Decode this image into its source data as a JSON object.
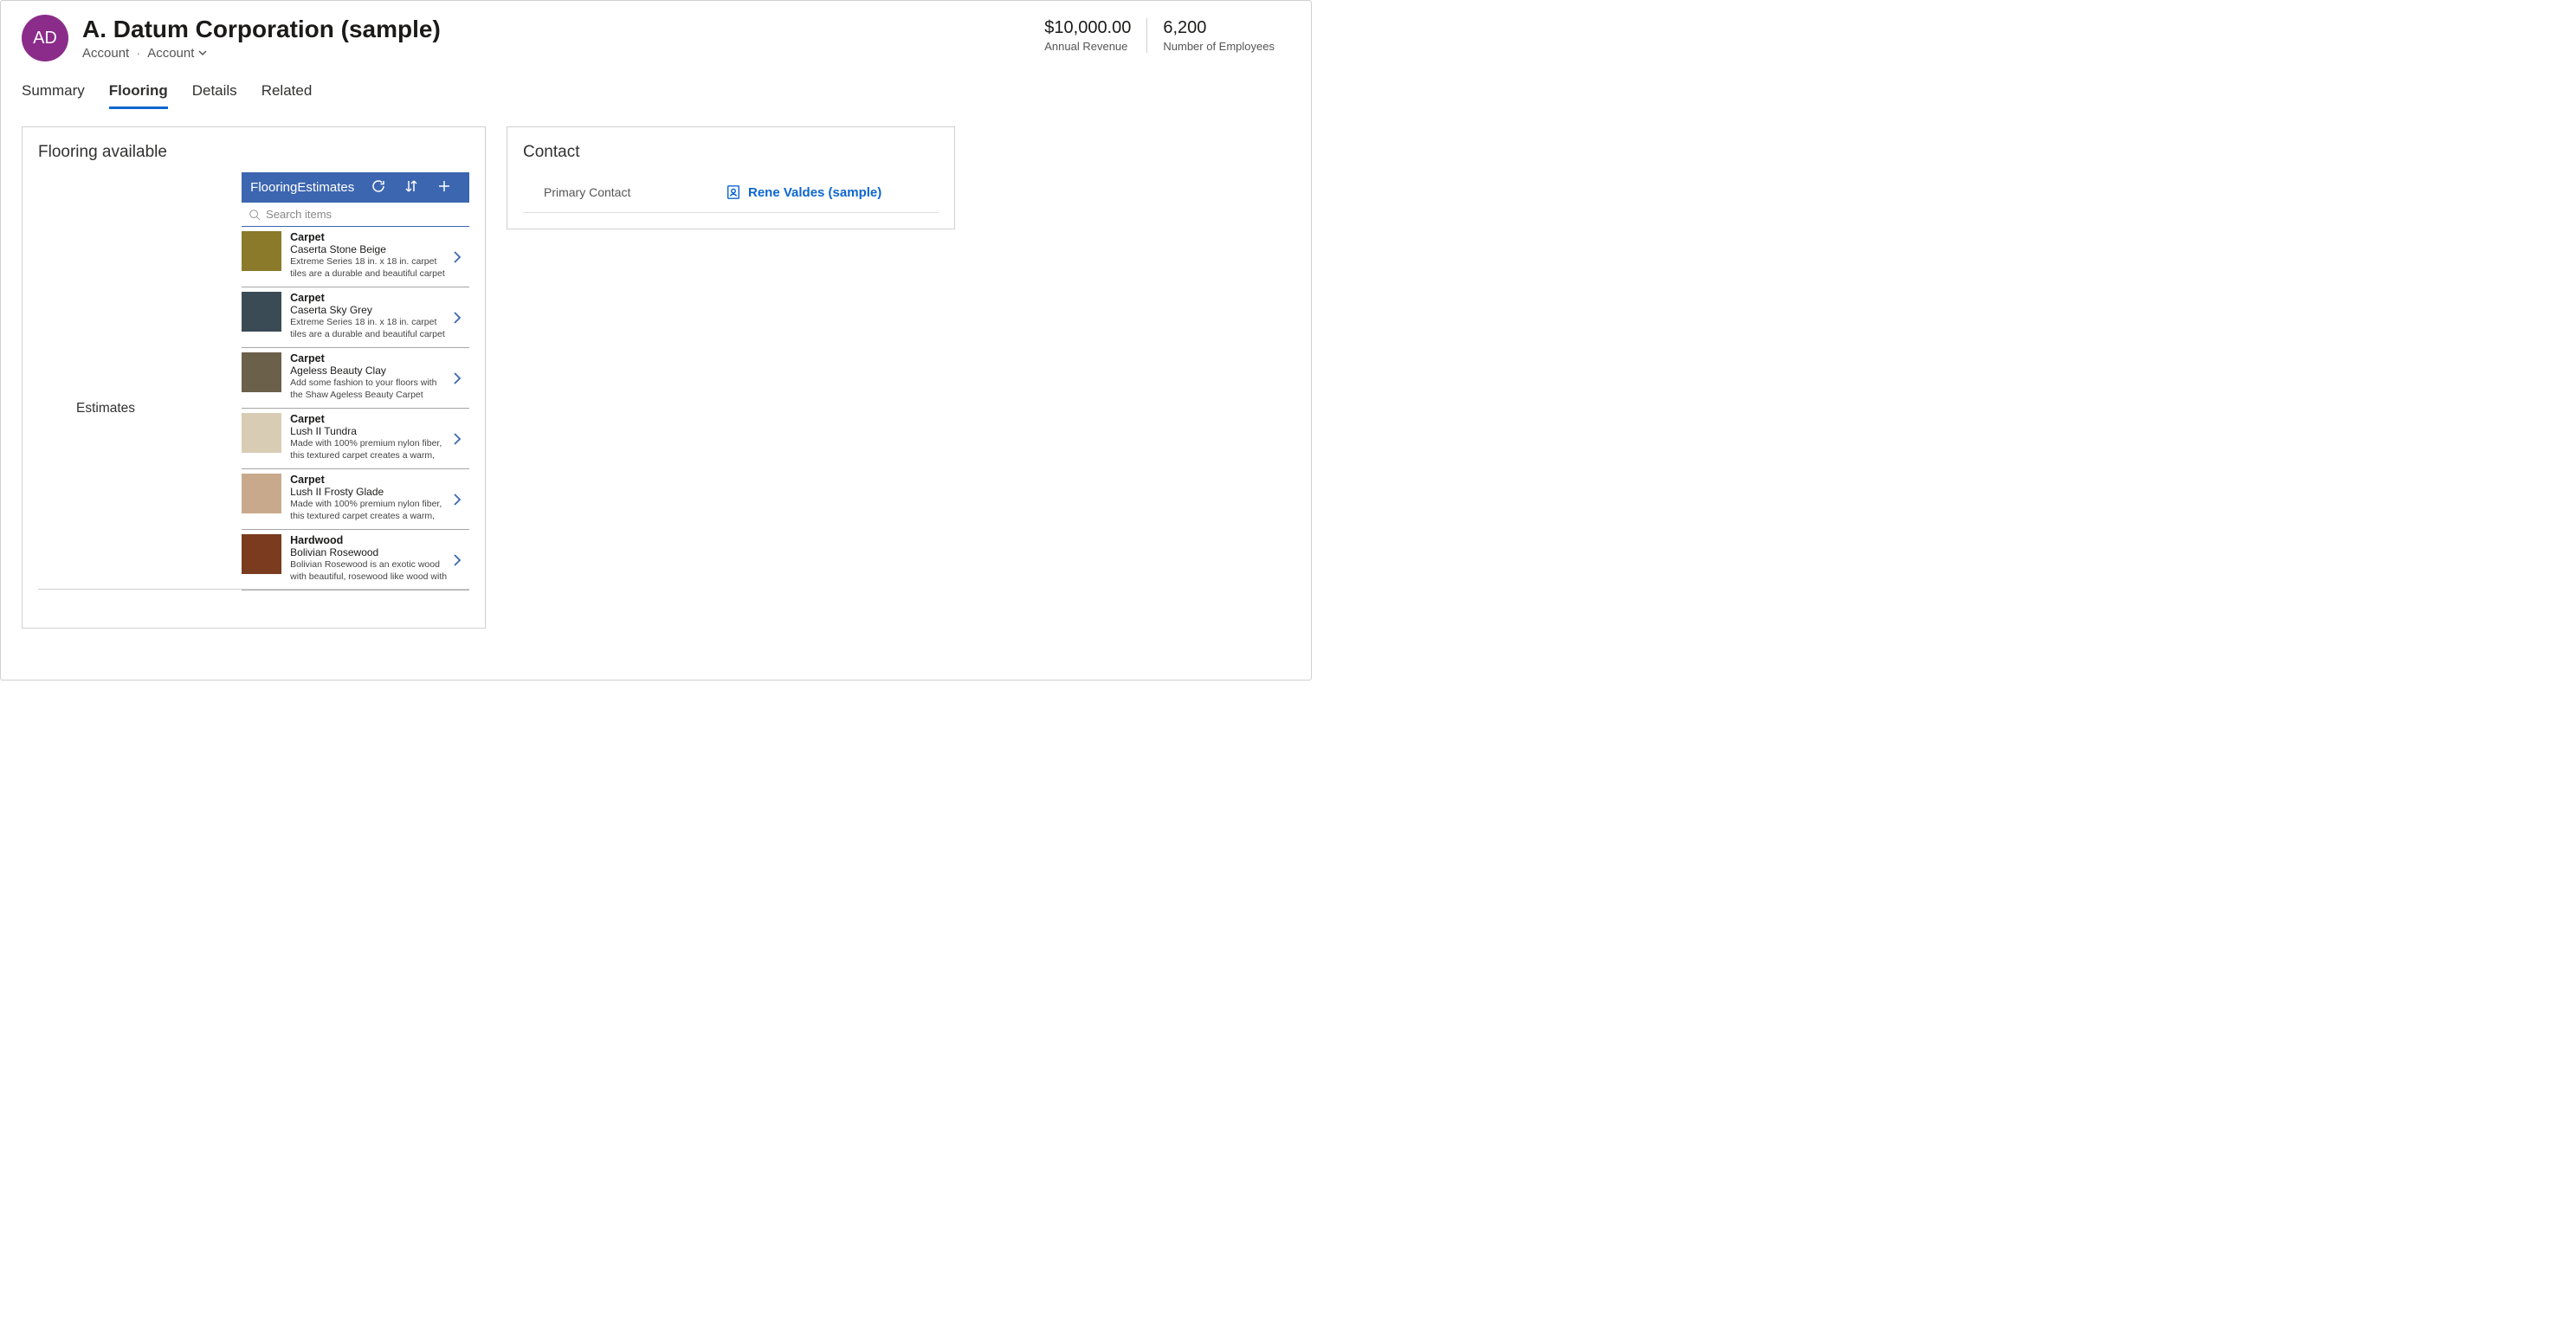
{
  "header": {
    "avatar_initials": "AD",
    "title": "A. Datum Corporation (sample)",
    "entity": "Account",
    "form": "Account"
  },
  "stats": [
    {
      "value": "$10,000.00",
      "label": "Annual Revenue"
    },
    {
      "value": "6,200",
      "label": "Number of Employees"
    }
  ],
  "tabs": [
    {
      "label": "Summary",
      "active": false
    },
    {
      "label": "Flooring",
      "active": true
    },
    {
      "label": "Details",
      "active": false
    },
    {
      "label": "Related",
      "active": false
    }
  ],
  "flooring": {
    "card_title": "Flooring available",
    "field_label": "Estimates",
    "gallery_title": "FlooringEstimates",
    "search_placeholder": "Search items",
    "items": [
      {
        "category": "Carpet",
        "name": "Caserta Stone Beige",
        "description": "Extreme Series 18 in. x 18 in. carpet tiles are a durable and beautiful carpet solution specially engineered for both",
        "swatch": "#8a7a2a"
      },
      {
        "category": "Carpet",
        "name": "Caserta Sky Grey",
        "description": "Extreme Series 18 in. x 18 in. carpet tiles are a durable and beautiful carpet solution specially engineered for both",
        "swatch": "#3b4b55"
      },
      {
        "category": "Carpet",
        "name": "Ageless Beauty Clay",
        "description": "Add some fashion to your floors with the Shaw Ageless Beauty Carpet collection.",
        "swatch": "#6b604a"
      },
      {
        "category": "Carpet",
        "name": "Lush II Tundra",
        "description": "Made with 100% premium nylon fiber, this textured carpet creates a warm, casual atmosphere that invites you to",
        "swatch": "#d8ccb4"
      },
      {
        "category": "Carpet",
        "name": "Lush II Frosty Glade",
        "description": "Made with 100% premium nylon fiber, this textured carpet creates a warm, casual atmosphere that invites you to",
        "swatch": "#c9a98b"
      },
      {
        "category": "Hardwood",
        "name": "Bolivian Rosewood",
        "description": "Bolivian Rosewood is an exotic wood with beautiful, rosewood like wood with",
        "swatch": "#7a3b1e"
      }
    ]
  },
  "contact": {
    "card_title": "Contact",
    "label": "Primary Contact",
    "link_text": "Rene Valdes (sample)"
  }
}
